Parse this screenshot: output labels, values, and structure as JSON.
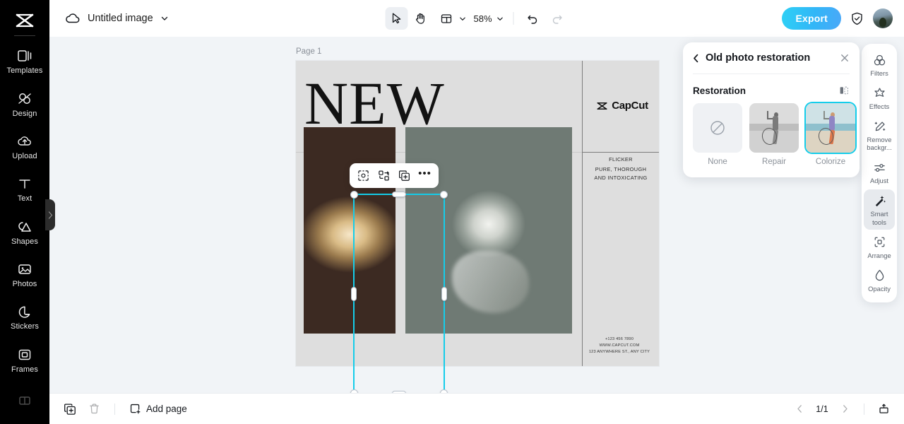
{
  "app": {
    "name": "CapCut",
    "logo_icon": "capcut-logo-icon"
  },
  "sidebar": {
    "items": [
      {
        "label": "Templates",
        "icon": "templates-icon"
      },
      {
        "label": "Design",
        "icon": "design-icon"
      },
      {
        "label": "Upload",
        "icon": "upload-cloud-icon"
      },
      {
        "label": "Text",
        "icon": "text-icon"
      },
      {
        "label": "Shapes",
        "icon": "shapes-icon"
      },
      {
        "label": "Photos",
        "icon": "photos-icon"
      },
      {
        "label": "Stickers",
        "icon": "stickers-icon"
      },
      {
        "label": "Frames",
        "icon": "frames-icon"
      },
      {
        "label": "",
        "icon": "layout-icon"
      }
    ],
    "toggle_icon": "chevron-right-icon"
  },
  "topbar": {
    "cloud_icon": "cloud-icon",
    "document_title": "Untitled image",
    "title_chevron_icon": "chevron-down-icon",
    "tools": [
      {
        "name": "select",
        "icon": "cursor-arrow-icon",
        "active": true
      },
      {
        "name": "hand",
        "icon": "hand-icon",
        "active": false
      },
      {
        "name": "layout",
        "icon": "layout-grid-icon",
        "active": false
      }
    ],
    "zoom_level": "58%",
    "zoom_chevron_icon": "chevron-down-icon",
    "undo_icon": "undo-icon",
    "redo_icon": "redo-icon",
    "export_label": "Export",
    "export_color": "#2ed0f5",
    "shield_icon": "shield-check-icon",
    "avatar_name": "avatar"
  },
  "canvas": {
    "page_label": "Page 1",
    "design": {
      "headline": "NEW",
      "brand": "CapCut",
      "right_text": {
        "line1": "FLICKER",
        "line2": "PURE, THOROUGH",
        "line3": "AND INTOXICATING"
      },
      "footer": {
        "phone": "+123 456 7890",
        "website": "WWW.CAPCUT.COM",
        "address": "123 ANYWHERE ST., ANY CITY"
      }
    },
    "selection": {
      "selected_element": "diamonds-photo",
      "border_color": "#15cdea",
      "rotate_icon": "rotate-icon"
    },
    "float_toolbar": [
      {
        "name": "crop-mask",
        "icon": "crop-mask-icon"
      },
      {
        "name": "replace",
        "icon": "replace-icon"
      },
      {
        "name": "duplicate",
        "icon": "duplicate-icon"
      },
      {
        "name": "more",
        "icon": "more-horizontal-icon",
        "label": "•••"
      }
    ]
  },
  "right_panel": {
    "back_icon": "chevron-left-icon",
    "title": "Old photo restoration",
    "close_icon": "close-icon",
    "section_title": "Restoration",
    "compare_icon": "compare-split-icon",
    "options": [
      {
        "label": "None",
        "icon": "no-effect-icon",
        "selected": false
      },
      {
        "label": "Repair",
        "icon": "repair-thumbnail",
        "selected": false
      },
      {
        "label": "Colorize",
        "icon": "colorize-thumbnail",
        "selected": true
      }
    ],
    "selected_option": "Colorize",
    "accent_color": "#15cdea"
  },
  "right_toolbar": {
    "items": [
      {
        "label": "Filters",
        "icon": "filters-icon",
        "active": false
      },
      {
        "label": "Effects",
        "icon": "effects-icon",
        "active": false
      },
      {
        "label": "Remove backgr...",
        "icon": "remove-background-icon",
        "active": false
      },
      {
        "label": "Adjust",
        "icon": "adjust-sliders-icon",
        "active": false
      },
      {
        "label": "Smart tools",
        "icon": "magic-wand-icon",
        "active": true
      },
      {
        "label": "Arrange",
        "icon": "arrange-icon",
        "active": false
      },
      {
        "label": "Opacity",
        "icon": "opacity-drop-icon",
        "active": false
      }
    ]
  },
  "bottombar": {
    "duplicate_icon": "duplicate-page-icon",
    "delete_icon": "trash-icon",
    "add_page_icon": "add-page-icon",
    "add_page_label": "Add page",
    "prev_icon": "chevron-left-icon",
    "page_indicator": "1/1",
    "next_icon": "chevron-right-icon",
    "present_icon": "present-icon"
  }
}
